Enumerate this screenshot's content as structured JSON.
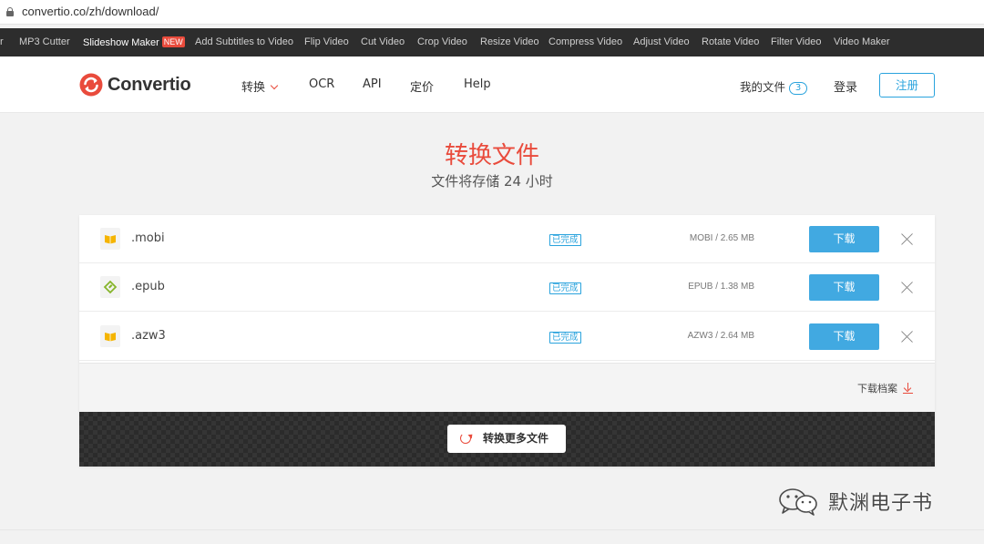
{
  "browser": {
    "url": "convertio.co/zh/download/"
  },
  "toolbar": {
    "items": [
      {
        "label": "r"
      },
      {
        "label": "MP3 Cutter"
      },
      {
        "label": "Slideshow Maker",
        "badge": "NEW"
      },
      {
        "label": "Add Subtitles to Video"
      },
      {
        "label": "Flip Video"
      },
      {
        "label": "Cut Video"
      },
      {
        "label": "Crop Video"
      },
      {
        "label": "Resize Video"
      },
      {
        "label": "Compress Video"
      },
      {
        "label": "Adjust Video"
      },
      {
        "label": "Rotate Video"
      },
      {
        "label": "Filter Video"
      },
      {
        "label": "Video Maker"
      }
    ]
  },
  "header": {
    "logo_text": "Convertio",
    "nav": [
      {
        "label": "转换"
      },
      {
        "label": "OCR"
      },
      {
        "label": "API"
      },
      {
        "label": "定价"
      },
      {
        "label": "Help"
      }
    ],
    "my_files_label": "我的文件",
    "my_files_count": "3",
    "login_label": "登录",
    "register_label": "注册"
  },
  "main": {
    "title": "转换文件",
    "subtitle": "文件将存储 24 小时",
    "files": [
      {
        "name": ".mobi",
        "status": "已完成",
        "size": "MOBI / 2.65 MB",
        "download_label": "下载",
        "icon": "book-icon"
      },
      {
        "name": ".epub",
        "status": "已完成",
        "size": "EPUB / 1.38 MB",
        "download_label": "下载",
        "icon": "epub-icon"
      },
      {
        "name": ".azw3",
        "status": "已完成",
        "size": "AZW3 / 2.64 MB",
        "download_label": "下载",
        "icon": "book-icon"
      }
    ],
    "archive_label": "下载档案",
    "convert_more_label": "转换更多文件"
  },
  "watermark": {
    "text": "默渊电子书"
  },
  "colors": {
    "accent": "#e94b3c",
    "blue": "#41a9e1",
    "link_blue": "#29a3dd",
    "dark": "#2d2d2d"
  }
}
